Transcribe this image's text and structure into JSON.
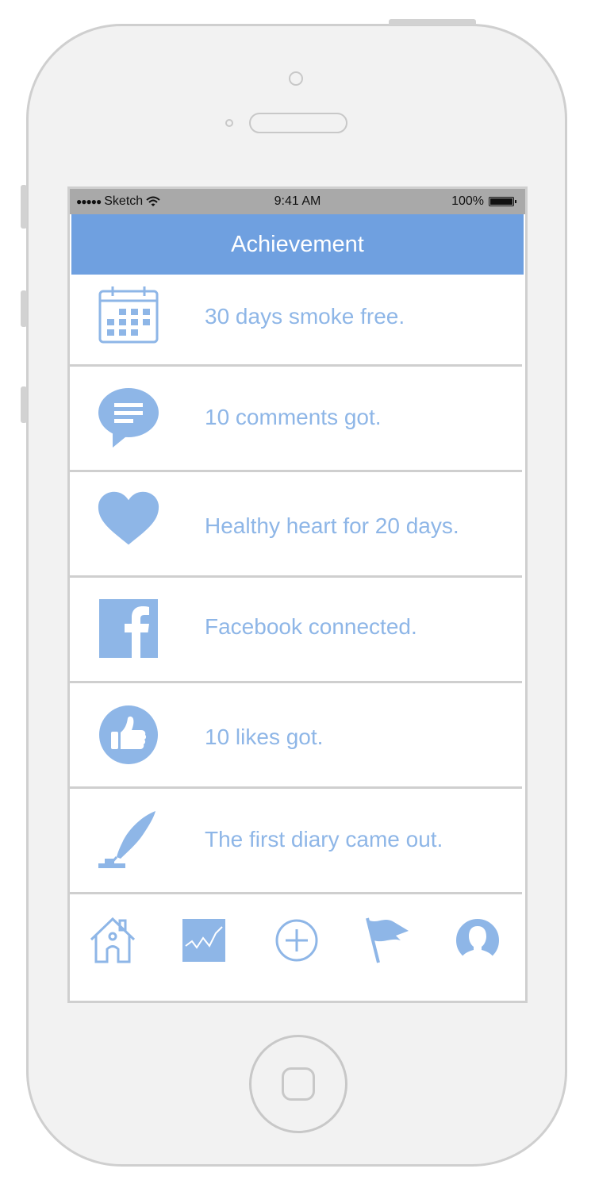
{
  "status_bar": {
    "carrier": "Sketch",
    "time": "9:41 AM",
    "battery": "100%"
  },
  "nav": {
    "title": "Achievement"
  },
  "achievements": [
    {
      "icon": "calendar-icon",
      "label": "30 days smoke free."
    },
    {
      "icon": "chat-bubble-icon",
      "label": "10 comments got."
    },
    {
      "icon": "heart-icon",
      "label": "Healthy heart for 20 days."
    },
    {
      "icon": "facebook-icon",
      "label": "Facebook connected."
    },
    {
      "icon": "thumbs-up-icon",
      "label": "10 likes got."
    },
    {
      "icon": "quill-pen-icon",
      "label": "The first diary came out."
    }
  ],
  "tab_bar": [
    {
      "icon": "home-icon"
    },
    {
      "icon": "chart-icon"
    },
    {
      "icon": "add-circle-icon"
    },
    {
      "icon": "flag-icon"
    },
    {
      "icon": "profile-icon"
    }
  ],
  "colors": {
    "accent": "#6fa0e0",
    "icon": "#8eb6e7",
    "status_bar": "#a9a9a9"
  }
}
